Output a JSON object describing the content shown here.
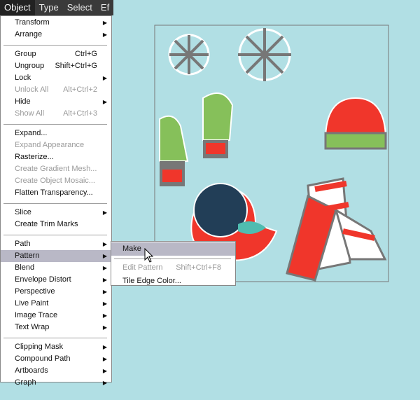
{
  "menubar": [
    "Object",
    "Type",
    "Select",
    "Ef"
  ],
  "menu": [
    {
      "label": "Transform",
      "arrow": true
    },
    {
      "label": "Arrange",
      "arrow": true
    },
    {
      "sep": true
    },
    {
      "label": "Group",
      "shortcut": "Ctrl+G"
    },
    {
      "label": "Ungroup",
      "shortcut": "Shift+Ctrl+G"
    },
    {
      "label": "Lock",
      "arrow": true
    },
    {
      "label": "Unlock All",
      "shortcut": "Alt+Ctrl+2",
      "disabled": true
    },
    {
      "label": "Hide",
      "arrow": true
    },
    {
      "label": "Show All",
      "shortcut": "Alt+Ctrl+3",
      "disabled": true
    },
    {
      "sep": true
    },
    {
      "label": "Expand..."
    },
    {
      "label": "Expand Appearance",
      "disabled": true
    },
    {
      "label": "Rasterize..."
    },
    {
      "label": "Create Gradient Mesh...",
      "disabled": true
    },
    {
      "label": "Create Object Mosaic...",
      "disabled": true
    },
    {
      "label": "Flatten Transparency..."
    },
    {
      "sep": true
    },
    {
      "label": "Slice",
      "arrow": true
    },
    {
      "label": "Create Trim Marks"
    },
    {
      "sep": true
    },
    {
      "label": "Path",
      "arrow": true
    },
    {
      "label": "Pattern",
      "arrow": true,
      "highlighted": true
    },
    {
      "label": "Blend",
      "arrow": true
    },
    {
      "label": "Envelope Distort",
      "arrow": true
    },
    {
      "label": "Perspective",
      "arrow": true
    },
    {
      "label": "Live Paint",
      "arrow": true
    },
    {
      "label": "Image Trace",
      "arrow": true
    },
    {
      "label": "Text Wrap",
      "arrow": true
    },
    {
      "sep": true
    },
    {
      "label": "Clipping Mask",
      "arrow": true
    },
    {
      "label": "Compound Path",
      "arrow": true
    },
    {
      "label": "Artboards",
      "arrow": true
    },
    {
      "label": "Graph",
      "arrow": true
    }
  ],
  "submenu": [
    {
      "label": "Make",
      "highlighted": true
    },
    {
      "sep": true
    },
    {
      "label": "Edit Pattern",
      "shortcut": "Shift+Ctrl+F8",
      "disabled": true
    },
    {
      "label": "Tile Edge Color..."
    }
  ],
  "colors": {
    "canvas": "#b1dfe4",
    "green": "#86c05a",
    "red": "#f0362b",
    "navy": "#223e57",
    "teal": "#4fbcb0",
    "gray": "#707070"
  }
}
